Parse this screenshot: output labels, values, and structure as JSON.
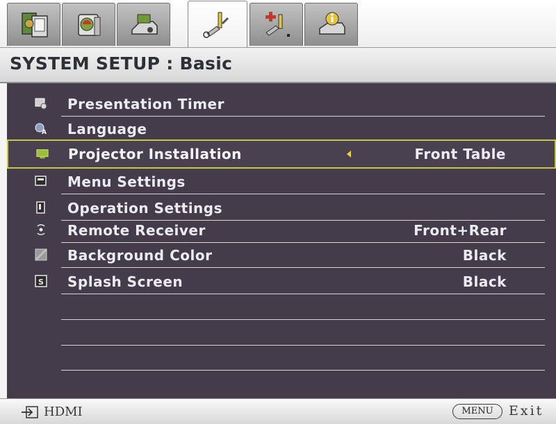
{
  "tabs": [
    {
      "icon": "picture-settings-icon",
      "active": false
    },
    {
      "icon": "advanced-picture-icon",
      "active": false
    },
    {
      "icon": "display-icon",
      "active": false
    },
    {
      "icon": "system-setup-basic-icon",
      "active": true
    },
    {
      "icon": "system-setup-advanced-icon",
      "active": false
    },
    {
      "icon": "information-icon",
      "active": false
    }
  ],
  "header": {
    "title": "SYSTEM SETUP : Basic"
  },
  "menu": {
    "items": [
      {
        "label": "Presentation Timer",
        "value": "",
        "icon": "timer-icon"
      },
      {
        "label": "Language",
        "value": "",
        "icon": "language-icon"
      },
      {
        "label": "Projector Installation",
        "value": "Front Table",
        "icon": "projector-installation-icon",
        "selected": true
      },
      {
        "label": "Menu Settings",
        "value": "",
        "icon": "menu-settings-icon"
      },
      {
        "label": "Operation Settings",
        "value": "",
        "icon": "operation-settings-icon"
      },
      {
        "label": "Remote Receiver",
        "value": "Front+Rear",
        "icon": "remote-receiver-icon"
      },
      {
        "label": "Background Color",
        "value": "Black",
        "icon": "background-color-icon"
      },
      {
        "label": "Splash Screen",
        "value": "Black",
        "icon": "splash-screen-icon"
      }
    ]
  },
  "footer": {
    "source": "HDMI",
    "menu_key": "MENU",
    "exit_label": "Exit"
  },
  "colors": {
    "panel_background": "#443b4b",
    "selection_border": "#c9c44a",
    "menu_text": "#ecebf2"
  }
}
